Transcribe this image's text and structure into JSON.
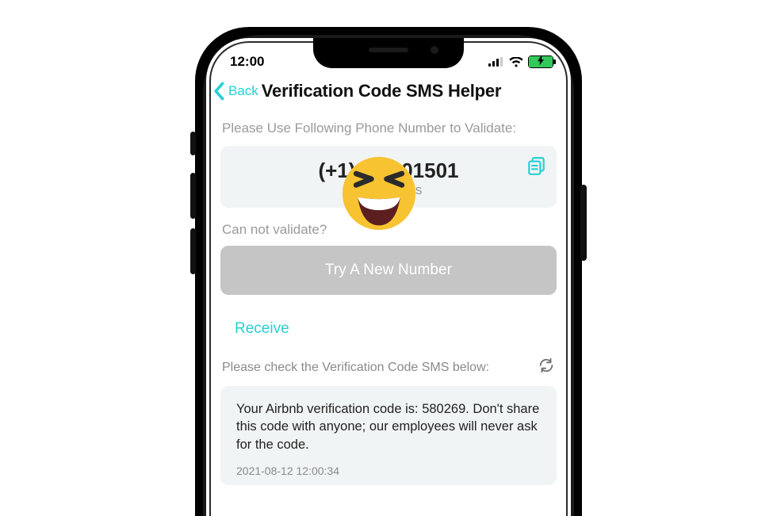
{
  "status": {
    "time": "12:00"
  },
  "nav": {
    "back": "Back",
    "title": "Verification Code SMS Helper"
  },
  "section": {
    "use_number_label": "Please Use Following Phone Number to Validate:",
    "phone_number": "(+1)        01501",
    "call_sms_hint": "R            /SMS",
    "cannot_validate": "Can not validate?",
    "try_new": "Try A New Number",
    "receive_tab": "Receive",
    "check_sms_label": "Please check the Verification Code SMS below:"
  },
  "sms": {
    "body": "Your Airbnb verification code is: 580269. Don't share this code with anyone; our employees will never ask for the code.",
    "timestamp": "2021-08-12 12:00:34"
  },
  "colors": {
    "accent": "#25d0d5",
    "card_bg": "#f1f4f4",
    "muted_text": "#9a9a9a",
    "button_disabled_bg": "#c5c5c5"
  }
}
